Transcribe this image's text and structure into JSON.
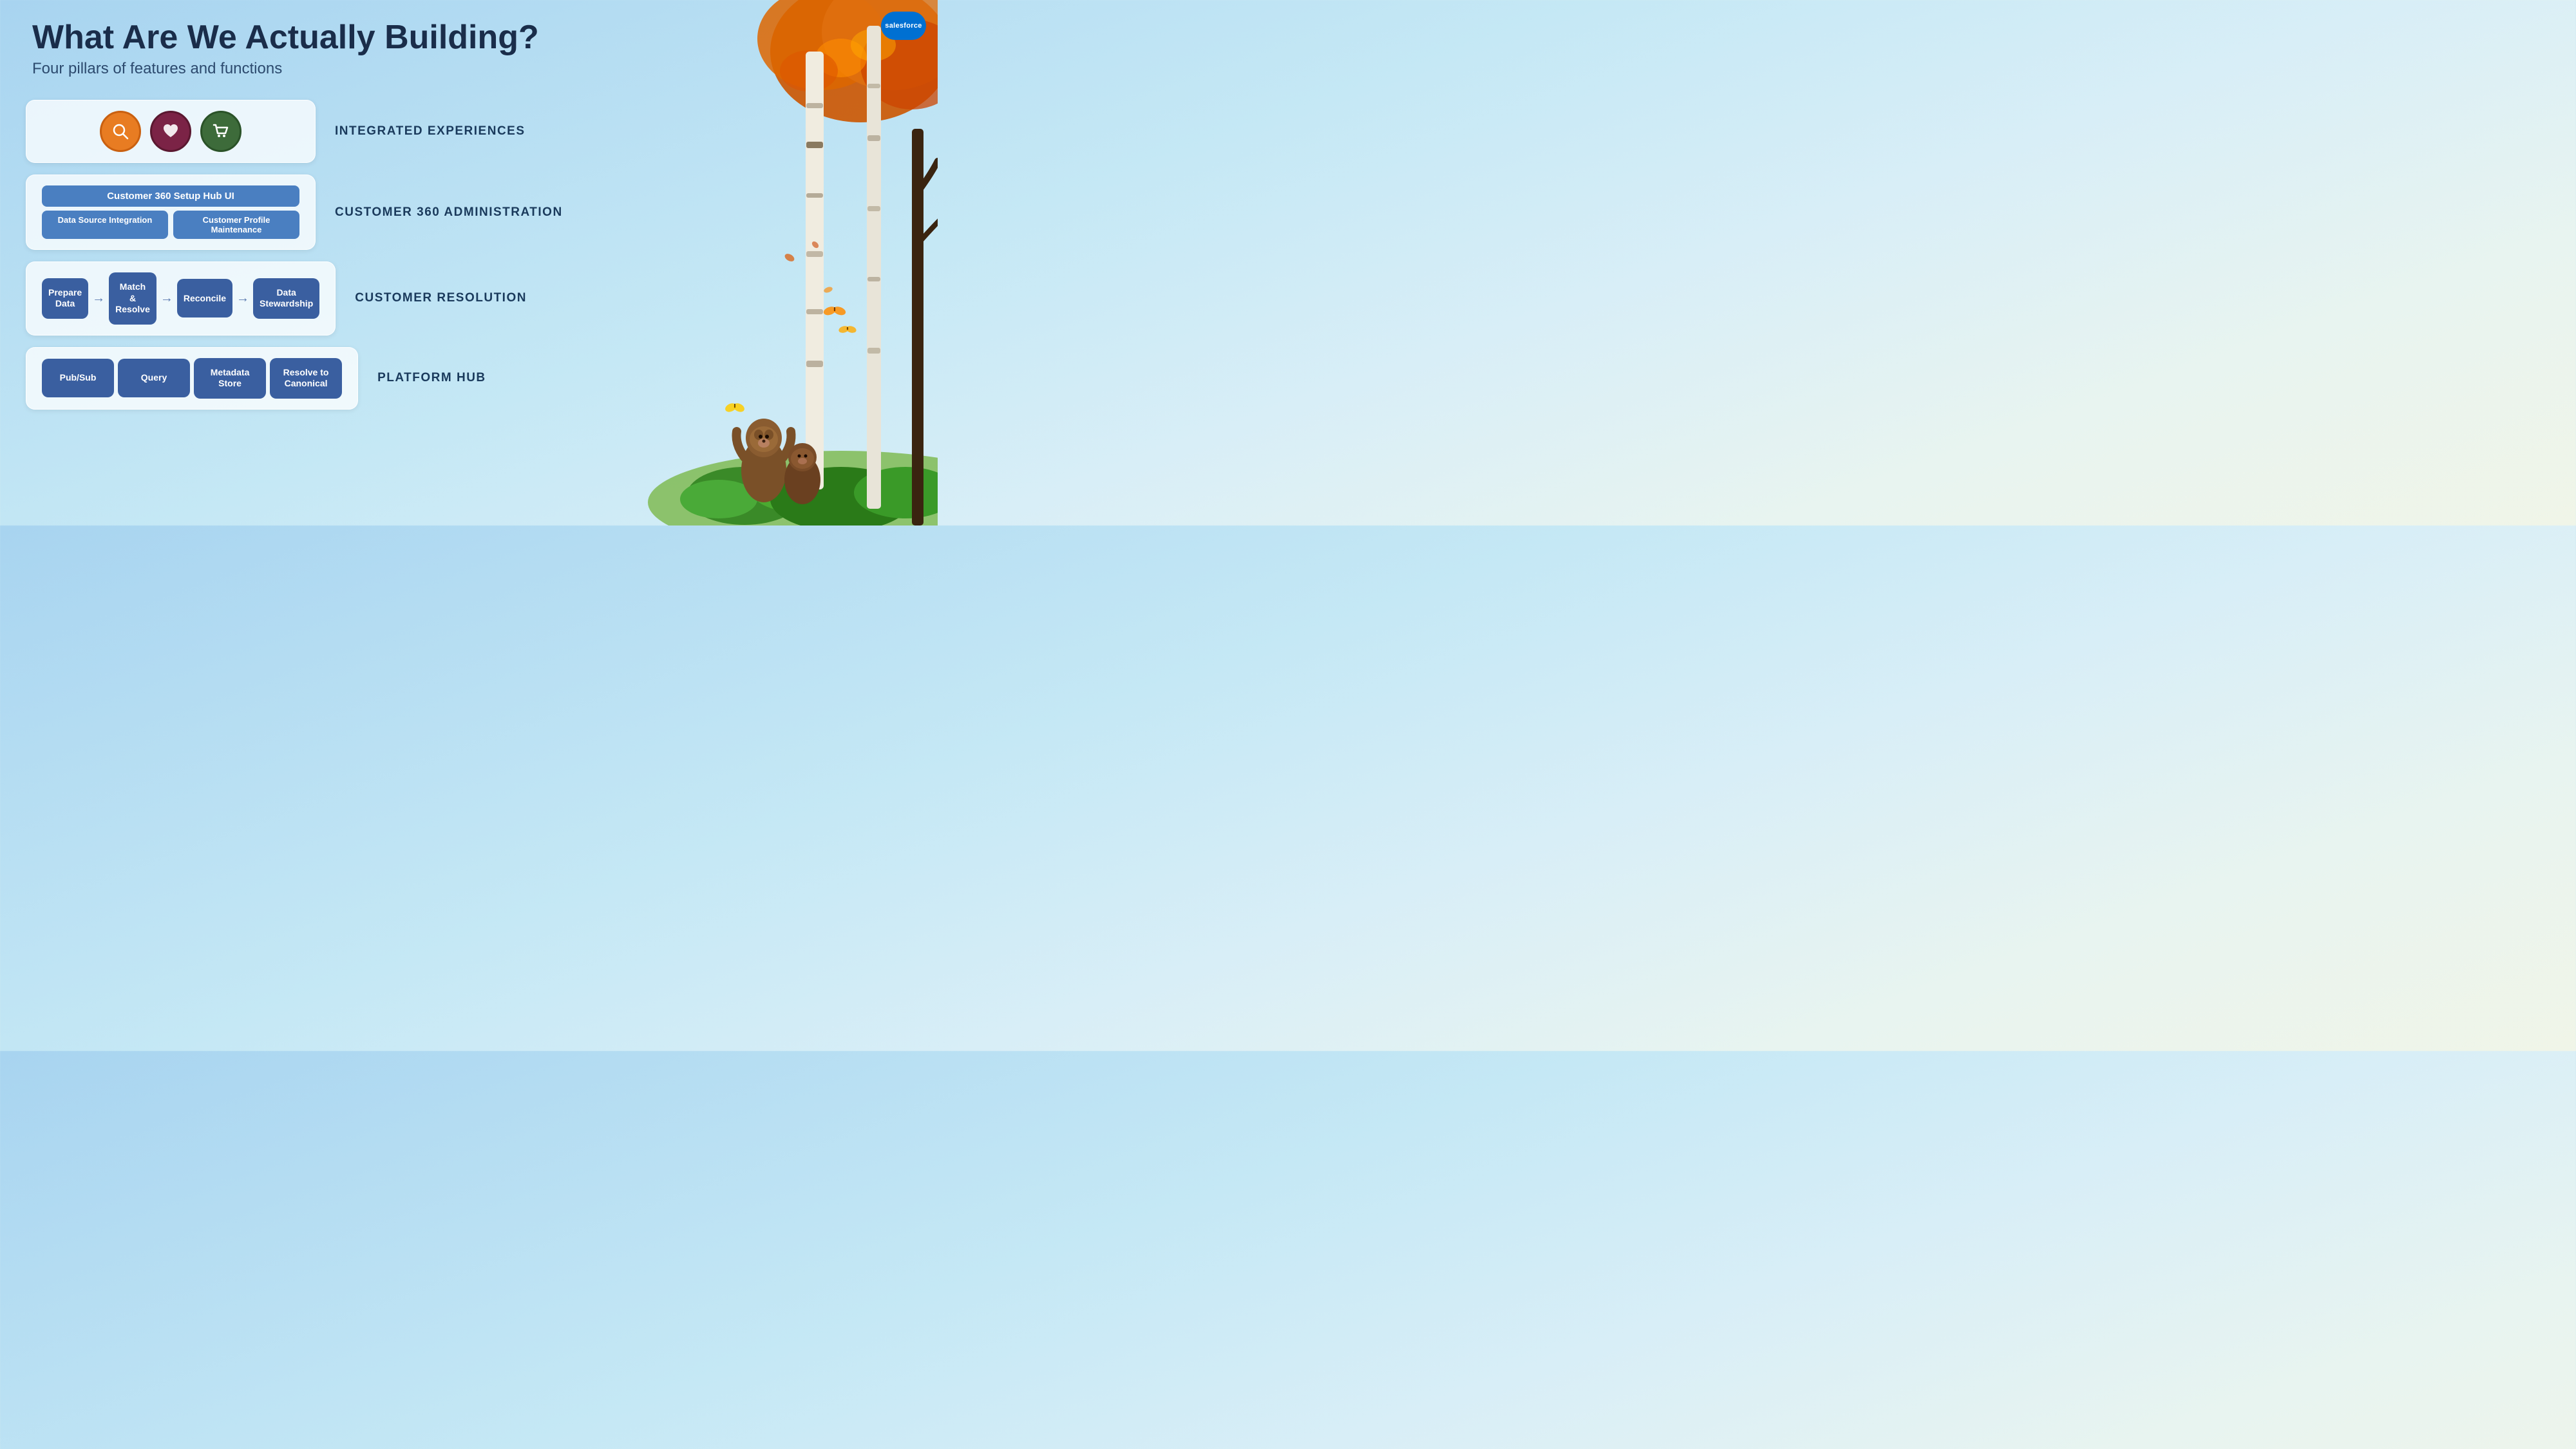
{
  "brand": {
    "logo_text": "salesforce"
  },
  "header": {
    "title": "What Are We Actually Building?",
    "subtitle": "Four pillars of features and functions"
  },
  "pillars": [
    {
      "id": "integrated-experiences",
      "label": "INTEGRATED EXPERIENCES",
      "type": "icons",
      "icons": [
        {
          "id": "search-icon",
          "color": "orange",
          "symbol": "🔍"
        },
        {
          "id": "heart-icon",
          "color": "crimson",
          "symbol": "♡"
        },
        {
          "id": "cart-icon",
          "color": "green",
          "symbol": "🛒"
        }
      ]
    },
    {
      "id": "customer-360-admin",
      "label": "CUSTOMER 360 ADMINISTRATION",
      "type": "admin",
      "header_bar": "Customer 360 Setup Hub UI",
      "sub_items": [
        "Data Source Integration",
        "Customer Profile Maintenance"
      ]
    },
    {
      "id": "customer-resolution",
      "label": "CUSTOMER RESOLUTION",
      "type": "steps",
      "steps": [
        "Prepare Data",
        "Match\n& Resolve",
        "Reconcile",
        "Data\nStewardship"
      ]
    },
    {
      "id": "platform-hub",
      "label": "PLATFORM HUB",
      "type": "steps",
      "steps": [
        "Pub/Sub",
        "Query",
        "Metadata\nStore",
        "Resolve to\nCanonical"
      ]
    }
  ]
}
